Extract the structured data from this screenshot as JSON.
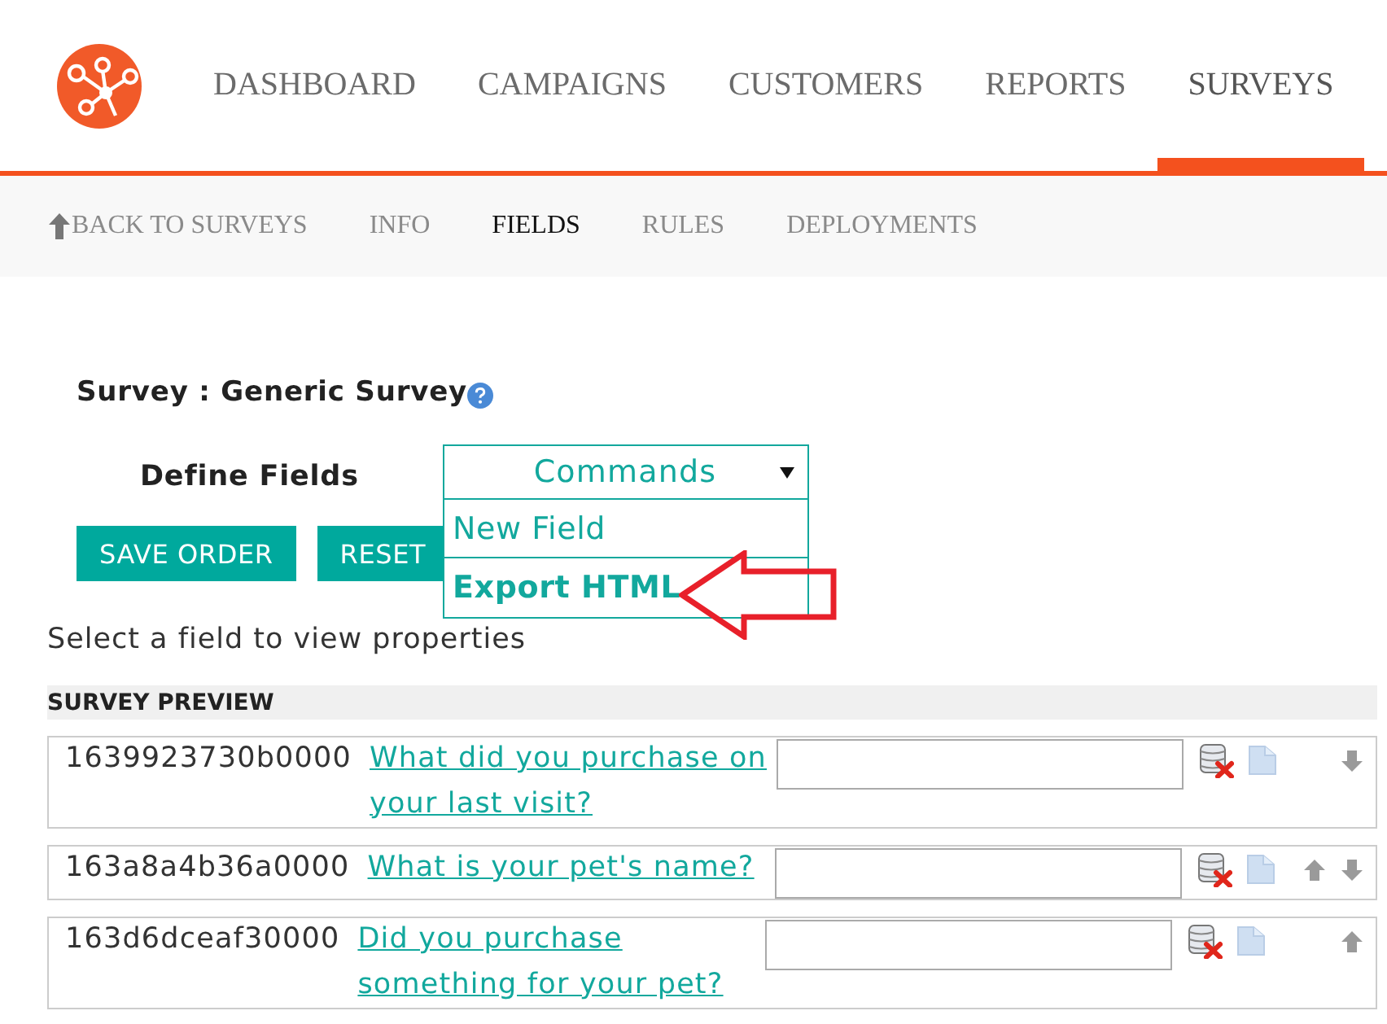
{
  "nav": {
    "items": [
      {
        "label": "DASHBOARD",
        "selected": false
      },
      {
        "label": "CAMPAIGNS",
        "selected": false
      },
      {
        "label": "CUSTOMERS",
        "selected": false
      },
      {
        "label": "REPORTS",
        "selected": false
      },
      {
        "label": "SURVEYS",
        "selected": true
      }
    ]
  },
  "subnav": {
    "back": "BACK TO SURVEYS",
    "items": [
      {
        "label": "INFO",
        "selected": false
      },
      {
        "label": "FIELDS",
        "selected": true
      },
      {
        "label": "RULES",
        "selected": false
      },
      {
        "label": "DEPLOYMENTS",
        "selected": false
      }
    ]
  },
  "survey_title": "Survey : Generic Survey",
  "define_fields": {
    "label": "Define Fields",
    "commands": {
      "label": "Commands",
      "expanded": true,
      "items": [
        {
          "label": "New Field",
          "selected": false
        },
        {
          "label": "Export HTML",
          "selected": true
        }
      ]
    }
  },
  "buttons": [
    "SAVE ORDER",
    "RESET"
  ],
  "hint": "Select a field to view properties",
  "preview": {
    "title": "SURVEY PREVIEW",
    "fields": [
      {
        "id": "1639923730b0000",
        "question": "What did you purchase on your last visit?",
        "can_move_up": false,
        "can_move_down": true
      },
      {
        "id": "163a8a4b36a0000",
        "question": "What is your pet's name?",
        "can_move_up": true,
        "can_move_down": true
      },
      {
        "id": "163d6dceaf30000",
        "question": "Did you purchase something for your pet?",
        "can_move_up": true,
        "can_move_down": false
      }
    ]
  }
}
